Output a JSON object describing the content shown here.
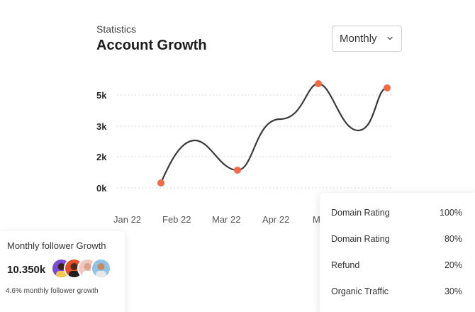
{
  "header": {
    "eyebrow": "Statistics",
    "title": "Account Growth"
  },
  "period_select": {
    "value": "Monthly"
  },
  "chart_data": {
    "type": "line",
    "y_ticks": [
      "5k",
      "3k",
      "2k",
      "0k"
    ],
    "x_ticks": [
      "Jan 22",
      "Feb 22",
      "Mar 22",
      "Apr 22",
      "M"
    ],
    "line_color": "#3a3a3a",
    "marker_color": "#f26b45",
    "grid": "dashed horizontal"
  },
  "follower_card": {
    "heading": "Monthly follower Growth",
    "value": "10.350k",
    "subtitle": "4.6% monthly follower growth",
    "avatars": [
      {
        "name": "avatar-1",
        "color": "#7a4bd6"
      },
      {
        "name": "avatar-2",
        "color": "#e2502a"
      },
      {
        "name": "avatar-3",
        "color": "#f1c7c0"
      },
      {
        "name": "avatar-4",
        "color": "#8fc4e8"
      }
    ]
  },
  "metrics": [
    {
      "label": "Domain Rating",
      "value": "100%"
    },
    {
      "label": "Domain Rating",
      "value": "80%"
    },
    {
      "label": "Refund",
      "value": "20%"
    },
    {
      "label": "Organic Traffic",
      "value": "30%"
    }
  ],
  "colors": {
    "accent": "#f26b45",
    "line": "#3a3a3a",
    "grid": "#d9d9d9"
  }
}
